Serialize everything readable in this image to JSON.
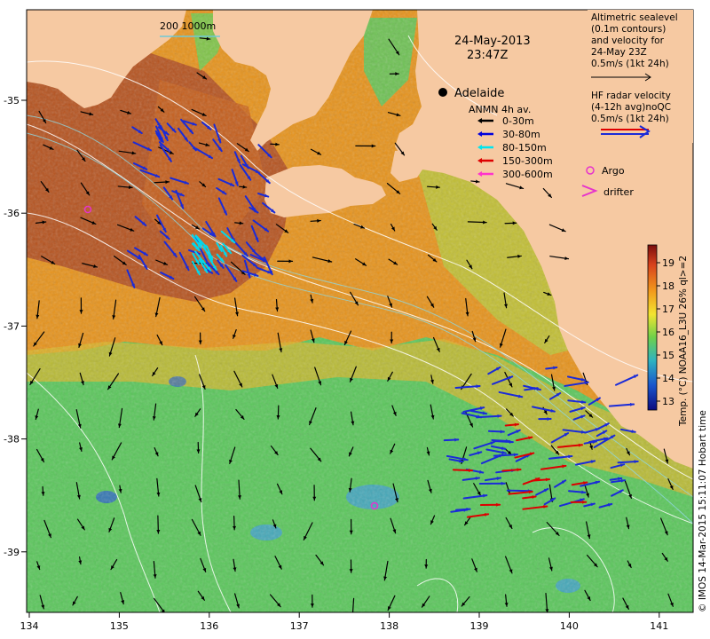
{
  "header": {
    "date": "24-May-2013",
    "time": "23:47Z",
    "depth_note": "200  1000m"
  },
  "place": {
    "city": "Adelaide"
  },
  "legend": {
    "anmn_title": "ANMN 4h av.",
    "anmn_items": [
      {
        "label": "0-30m",
        "color": "#000000"
      },
      {
        "label": "30-80m",
        "color": "#0000dd"
      },
      {
        "label": "80-150m",
        "color": "#00e5ee"
      },
      {
        "label": "150-300m",
        "color": "#dd0000"
      },
      {
        "label": "300-600m",
        "color": "#ff33cc"
      }
    ],
    "argo": "Argo",
    "drifter": "drifter",
    "altimetric_lines": [
      "Altimetric sealevel",
      "(0.1m contours)",
      "and velocity for",
      "24-May 23Z",
      "0.5m/s (1kt 24h)"
    ],
    "hf_lines": [
      "HF radar velocity",
      "(4-12h avg)noQC",
      "0.5m/s (1kt 24h)"
    ]
  },
  "colorbar": {
    "ticks": [
      "19",
      "18",
      "17",
      "16",
      "15",
      "14",
      "13"
    ],
    "label": "Temp. (°C) NOAA16_L3U 26% ql>=2"
  },
  "axes": {
    "x_ticks": [
      "134",
      "135",
      "136",
      "137",
      "138",
      "139",
      "140",
      "141"
    ],
    "y_ticks": [
      "-35",
      "-36",
      "-37",
      "-38",
      "-39"
    ]
  },
  "credit": "© IMOS 14-Mar-2015 15:11:07 Hobart time",
  "colors": {
    "land": "#f6c9a2",
    "warm": "#e08a16",
    "hot": "#b74a1a",
    "cool": "#56c45a",
    "cold": "#1fa0c8"
  }
}
